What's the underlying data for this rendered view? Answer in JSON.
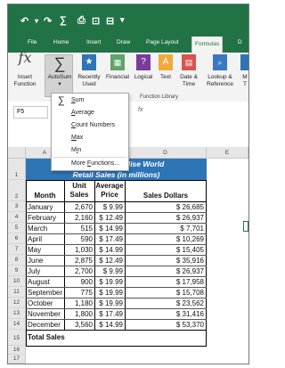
{
  "quick_access": {
    "undo": "↶",
    "redo": "↷",
    "sum": "∑",
    "save": "⊟",
    "customize": "▾"
  },
  "ribbon_tabs": [
    "File",
    "Home",
    "Insert",
    "Draw",
    "Page Layout",
    "Formulas",
    "D"
  ],
  "active_tab": "Formulas",
  "ribbon_buttons": {
    "insert_function": "Insert\nFunction",
    "autosum": "AutoSum",
    "recently_used": "Recently\nUsed",
    "financial": "Financial",
    "logical": "Logical",
    "text": "Text",
    "date_time": "Date &\nTime",
    "lookup_reference": "Lookup &\nReference",
    "math": "M\nT"
  },
  "group_label": "Function Library",
  "name_box": "F5",
  "formula_bar_fx": "fx",
  "autosum_menu": {
    "items": [
      {
        "label": "Sum",
        "key": "S",
        "icon": "∑"
      },
      {
        "label": "Average",
        "key": "A"
      },
      {
        "label": "Count Numbers",
        "key": "C"
      },
      {
        "label": "Max",
        "key": "M"
      },
      {
        "label": "Min",
        "key": "I"
      },
      {
        "label": "More Functions...",
        "key": "F"
      }
    ]
  },
  "column_headers": [
    "A",
    "B",
    "C",
    "D",
    "E"
  ],
  "row_numbers": [
    "1",
    "2",
    "3",
    "4",
    "5",
    "6",
    "7",
    "8",
    "9",
    "10",
    "11",
    "12",
    "13",
    "14",
    "15",
    "16",
    "17"
  ],
  "sheet": {
    "title_line1": "Mo Better Merchandise World",
    "title_line2": "Retail Sales (in millions)",
    "title_line1_visible": "dise World",
    "headers": {
      "month": "Month",
      "units": "Unit Sales",
      "price": "Average Price",
      "sales": "Sales Dollars"
    },
    "rows": [
      {
        "month": "January",
        "units": "2,670",
        "price": "$ 9.99",
        "sales": "$ 26,685"
      },
      {
        "month": "February",
        "units": "2,160",
        "price": "$ 12.49",
        "sales": "$ 26,937"
      },
      {
        "month": "March",
        "units": "515",
        "price": "$ 14.99",
        "sales": "$ 7,701"
      },
      {
        "month": "April",
        "units": "590",
        "price": "$ 17.49",
        "sales": "$ 10,269"
      },
      {
        "month": "May",
        "units": "1,030",
        "price": "$ 14.99",
        "sales": "$ 15,405"
      },
      {
        "month": "June",
        "units": "2,875",
        "price": "$ 12.49",
        "sales": "$ 35,916"
      },
      {
        "month": "July",
        "units": "2,700",
        "price": "$ 9.99",
        "sales": "$ 26,937"
      },
      {
        "month": "August",
        "units": "900",
        "price": "$ 19.99",
        "sales": "$ 17,958"
      },
      {
        "month": "September",
        "units": "775",
        "price": "$ 19.99",
        "sales": "$ 15,708"
      },
      {
        "month": "October",
        "units": "1,180",
        "price": "$ 19.99",
        "sales": "$ 23,562"
      },
      {
        "month": "November",
        "units": "1,800",
        "price": "$ 17.49",
        "sales": "$ 31,416"
      },
      {
        "month": "December",
        "units": "3,560",
        "price": "$ 14.99",
        "sales": "$ 53,370"
      }
    ],
    "total_label": "Total Sales"
  },
  "colors": {
    "excel_green": "#217346",
    "title_blue": "#2e75b6"
  }
}
